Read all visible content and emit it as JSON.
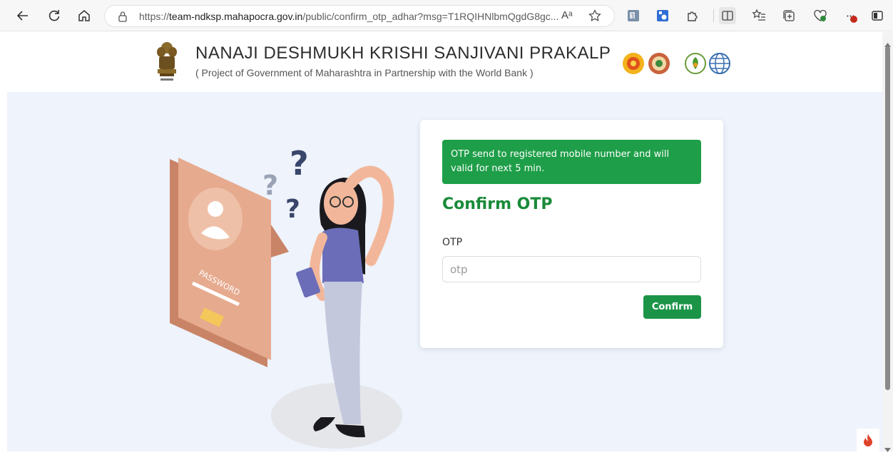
{
  "browser": {
    "url_prefix": "https://",
    "url_host": "team-ndksp.mahapocra.gov.in",
    "url_path": "/public/confirm_otp_adhar?msg=T1RQIHNlbmQgdG8gc...",
    "read_aloud_glyph": "Aᵃ",
    "more_glyph": "···"
  },
  "header": {
    "title": "NANAJI DESHMUKH KRISHI SANJIVANI PRAKALP",
    "subtitle": "( Project of Government of Maharashtra in Partnership with the World Bank )"
  },
  "card": {
    "alert_message": "OTP send to registered mobile number and will valid for next 5 min.",
    "title": "Confirm OTP",
    "otp_label": "OTP",
    "otp_placeholder": "otp",
    "otp_value": "",
    "confirm_label": "Confirm"
  },
  "illustration": {
    "badge_text": "PASSWORD"
  },
  "colors": {
    "accent_green": "#1e9e48",
    "page_bg": "#eef3fc"
  },
  "icons": [
    "back-arrow-icon",
    "refresh-icon",
    "home-icon",
    "lock-icon",
    "read-aloud-icon",
    "favorite-star-icon",
    "extension-n-icon",
    "extension-blue-icon",
    "extension-puzzle-icon",
    "split-screen-icon",
    "favorites-list-icon",
    "collections-icon",
    "health-icon",
    "more-options-icon",
    "sidebar-toggle-icon",
    "scroll-up-icon",
    "scroll-down-icon",
    "flame-icon"
  ]
}
